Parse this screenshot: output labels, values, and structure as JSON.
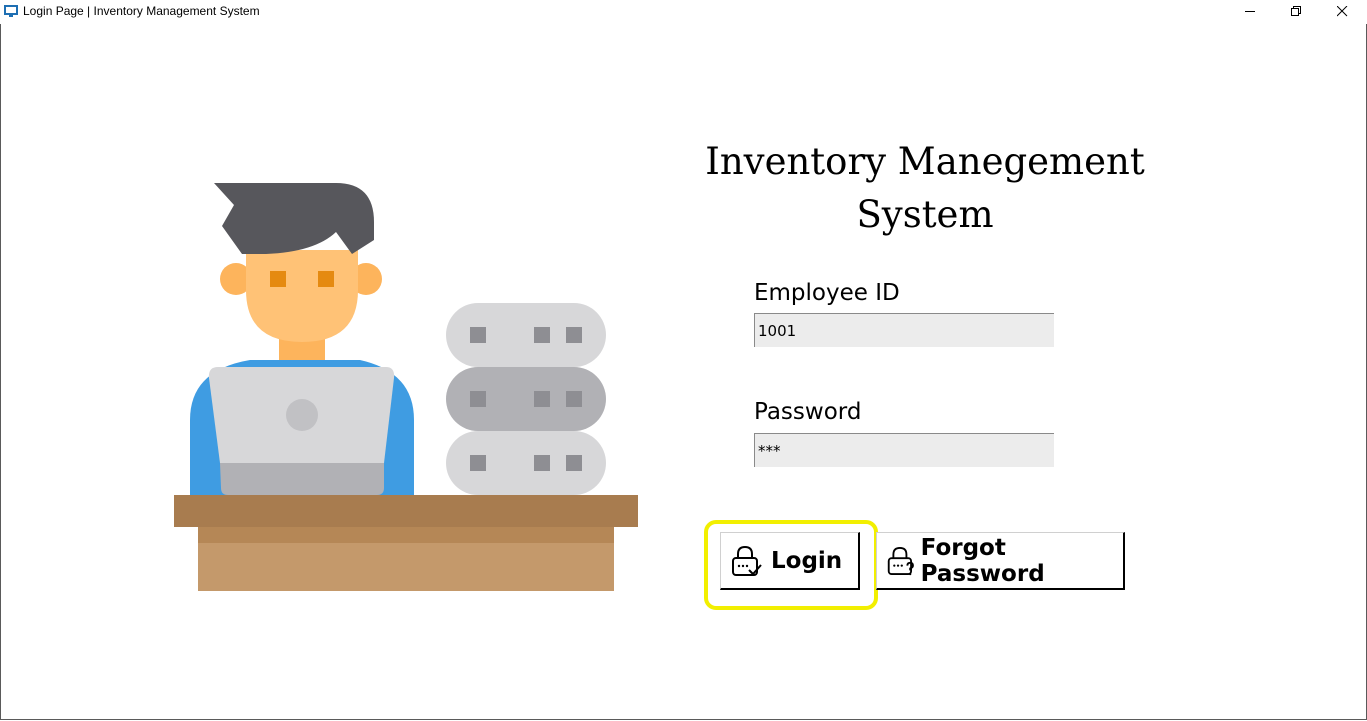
{
  "window": {
    "title": "Login Page | Inventory Management System",
    "icons": [
      "app-icon",
      "minimize-icon",
      "restore-icon",
      "close-icon"
    ]
  },
  "app": {
    "title_line1": "Inventory Manegement",
    "title_line2": "System"
  },
  "form": {
    "employee_id_label": "Employee ID",
    "employee_id_value": "1001",
    "password_label": "Password",
    "password_value": "***"
  },
  "buttons": {
    "login_label": "Login",
    "forgot_label": "Forgot Password",
    "login_icon": "lock-check-icon",
    "forgot_icon": "lock-question-icon"
  },
  "colors": {
    "focus_ring": "#f2ef00",
    "input_bg": "#ececec"
  }
}
